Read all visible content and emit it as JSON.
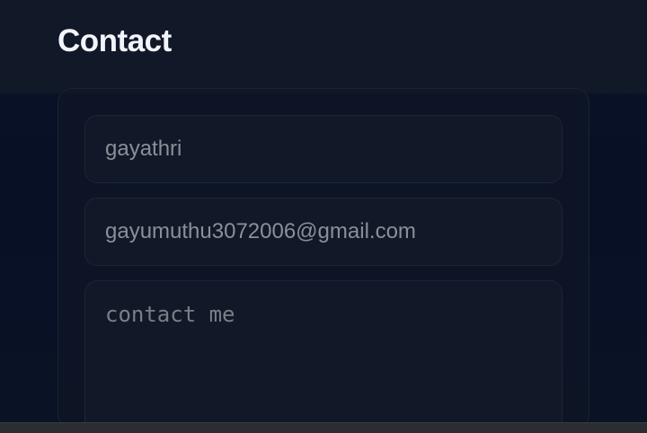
{
  "header": {
    "title": "Contact"
  },
  "form": {
    "name_value": "gayathri",
    "email_value": "gayumuthu3072006@gmail.com",
    "message_placeholder": "contact me"
  },
  "colors": {
    "header_bg": "#111827",
    "page_bg": "#081026",
    "field_bg": "#111827",
    "title_text": "#f2f4fb",
    "field_text": "#8b8f98"
  }
}
